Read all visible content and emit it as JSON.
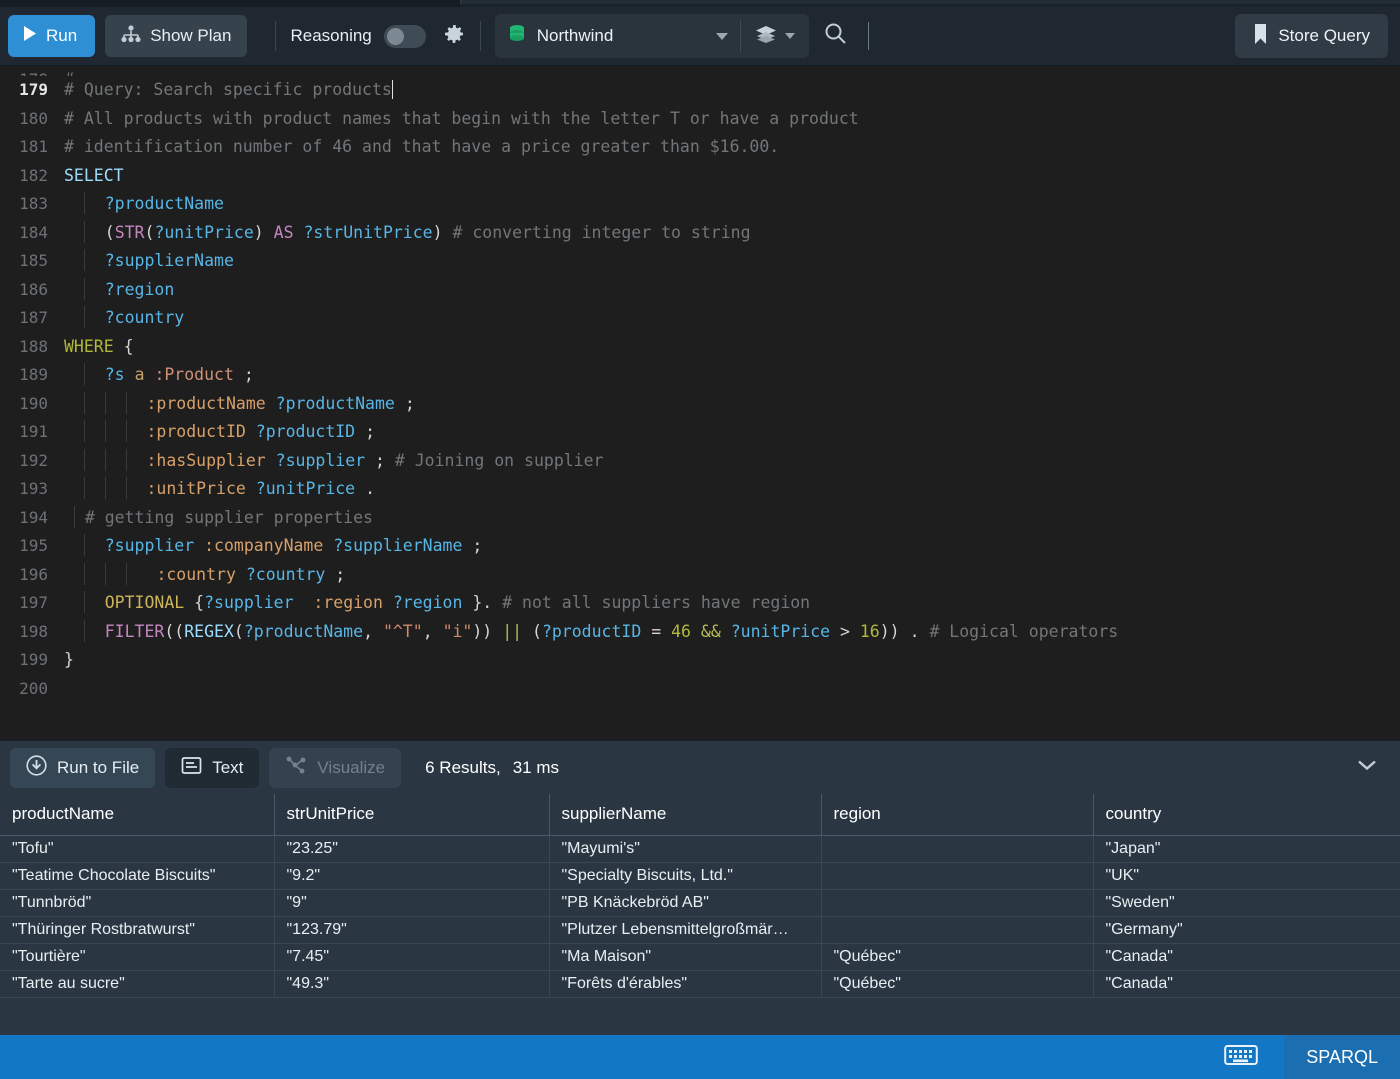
{
  "toolbar": {
    "run_label": "Run",
    "show_plan_label": "Show Plan",
    "reasoning_label": "Reasoning",
    "reasoning_on": false,
    "gear_icon": "gear-icon",
    "database_name": "Northwind",
    "database_icon": "database-icon",
    "layers_icon": "layers-icon",
    "search_icon": "search-icon",
    "store_query_label": "Store Query",
    "bookmark_icon": "bookmark-icon",
    "accent_color": "#2e8fd4"
  },
  "editor": {
    "language": "SPARQL",
    "first_visible_line": 179,
    "lines": [
      {
        "n": 179,
        "current": true
      },
      {
        "n": 180
      },
      {
        "n": 181
      },
      {
        "n": 182
      },
      {
        "n": 183
      },
      {
        "n": 184
      },
      {
        "n": 185
      },
      {
        "n": 186
      },
      {
        "n": 187
      },
      {
        "n": 188
      },
      {
        "n": 189
      },
      {
        "n": 190
      },
      {
        "n": 191
      },
      {
        "n": 192
      },
      {
        "n": 193
      },
      {
        "n": 194
      },
      {
        "n": 195
      },
      {
        "n": 196
      },
      {
        "n": 197
      },
      {
        "n": 198
      },
      {
        "n": 199
      },
      {
        "n": 200
      }
    ],
    "text": {
      "l179": "# Query: Search specific products",
      "l180": "# All products with product names that begin with the letter T or have a product",
      "l181": "# identification number of 46 and that have a price greater than $16.00.",
      "l182": "SELECT",
      "l183": "?productName",
      "l184": "(STR(?unitPrice) AS ?strUnitPrice) # converting integer to string",
      "l185": "?supplierName",
      "l186": "?region",
      "l187": "?country",
      "l188": "WHERE {",
      "l189": "?s a :Product ;",
      "l190": ":productName ?productName ;",
      "l191": ":productID ?productID ;",
      "l192": ":hasSupplier ?supplier ; # Joining on supplier",
      "l193": ":unitPrice ?unitPrice .",
      "l194": "# getting supplier properties",
      "l195": "?supplier :companyName ?supplierName ;",
      "l196": ":country ?country ;",
      "l197": "OPTIONAL {?supplier  :region ?region }. # not all suppliers have region",
      "l198": "FILTER((REGEX(?productName, \"^T\", \"i\")) || (?productID = 46 && ?unitPrice > 16)) . # Logical operators",
      "l199": "}",
      "l200": ""
    }
  },
  "results": {
    "run_to_file_label": "Run to File",
    "text_label": "Text",
    "visualize_label": "Visualize",
    "visualize_enabled": false,
    "result_count_label": "6 Results,",
    "elapsed_label": "31 ms",
    "collapse_icon": "chevron-down-icon",
    "columns": [
      "productName",
      "strUnitPrice",
      "supplierName",
      "region",
      "country"
    ],
    "rows": [
      [
        "\"Tofu\"",
        "\"23.25\"",
        "\"Mayumi's\"",
        "",
        "\"Japan\""
      ],
      [
        "\"Teatime Chocolate Biscuits\"",
        "\"9.2\"",
        "\"Specialty Biscuits, Ltd.\"",
        "",
        "\"UK\""
      ],
      [
        "\"Tunnbröd\"",
        "\"9\"",
        "\"PB Knäckebröd AB\"",
        "",
        "\"Sweden\""
      ],
      [
        "\"Thüringer Rostbratwurst\"",
        "\"123.79\"",
        "\"Plutzer Lebensmittelgroßmär…",
        "",
        "\"Germany\""
      ],
      [
        "\"Tourtière\"",
        "\"7.45\"",
        "\"Ma Maison\"",
        "\"Québec\"",
        "\"Canada\""
      ],
      [
        "\"Tarte au sucre\"",
        "\"49.3\"",
        "\"Forêts d'érables\"",
        "\"Québec\"",
        "\"Canada\""
      ]
    ]
  },
  "statusbar": {
    "keyboard_icon": "keyboard-icon",
    "language_label": "SPARQL",
    "background_color": "#1277c4"
  }
}
